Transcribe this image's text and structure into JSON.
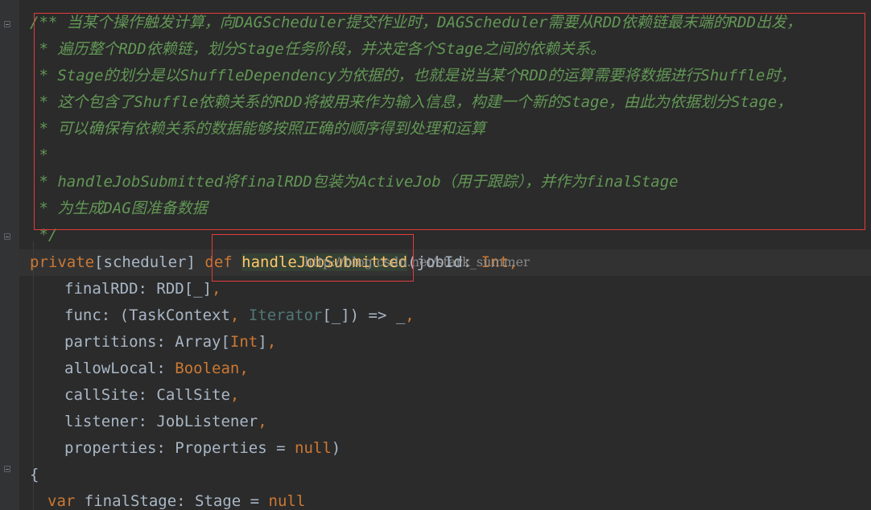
{
  "comment": {
    "lines": [
      "/** 当某个操作触发计算，向DAGScheduler提交作业时，DAGScheduler需要从RDD依赖链最末端的RDD出发，",
      " * 遍历整个RDD依赖链，划分Stage任务阶段，并决定各个Stage之间的依赖关系。",
      " * Stage的划分是以ShuffleDependency为依据的，也就是说当某个RDD的运算需要将数据进行Shuffle时，",
      " * 这个包含了Shuffle依赖关系的RDD将被用来作为输入信息，构建一个新的Stage，由此为依据划分Stage，",
      " * 可以确保有依赖关系的数据能够按照正确的顺序得到处理和运算",
      " *",
      " * handleJobSubmitted将finalRDD包装为ActiveJob（用于跟踪），并作为finalStage",
      " * 为生成DAG图准备数据",
      " */"
    ]
  },
  "signature": {
    "private": "private",
    "scope": "[scheduler]",
    "def": "def",
    "name": "handleJobSubmitted",
    "paren": "(",
    "param": "jobId: ",
    "param_type": "Int,"
  },
  "params": {
    "finalRDD": {
      "name": "finalRDD: ",
      "type": "RDD[_]",
      "comma": ","
    },
    "func": {
      "name": "func: ",
      "type_a": "(TaskContext",
      "comma1": ",",
      "type_b": " Iterator",
      "type_c": "[_]) => _",
      "comma2": ","
    },
    "partitions": {
      "name": "partitions: ",
      "type": "Array[",
      "inner": "Int",
      "close": "]",
      "comma": ","
    },
    "allowLocal": {
      "name": "allowLocal: ",
      "type": "Boolean",
      "comma": ","
    },
    "callSite": {
      "name": "callSite: ",
      "type": "CallSite",
      "comma": ","
    },
    "listener": {
      "name": "listener: ",
      "type": "JobListener",
      "comma": ","
    },
    "properties": {
      "name": "properties: ",
      "type": "Properties = ",
      "null": "null",
      "close": ")"
    }
  },
  "body": {
    "open_brace": "{",
    "var": "var",
    "decl": " finalStage: Stage = ",
    "null": "null"
  },
  "watermark": "http://blog.csdn.net/stark_summer",
  "colors": {
    "background": "#2b2b2b",
    "comment": "#629755",
    "keyword": "#cc7832",
    "function": "#ffc66d",
    "text": "#a9b7c6",
    "highlight_box": "#e33b3b"
  },
  "icons": [
    "fold-icon"
  ]
}
